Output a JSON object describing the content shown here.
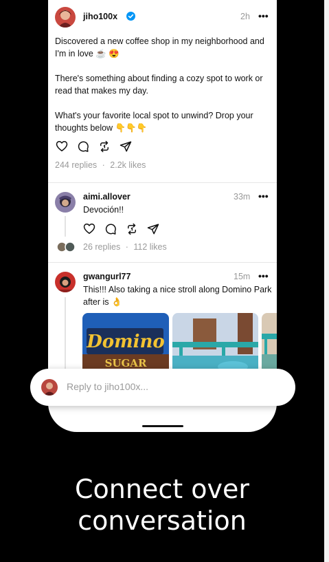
{
  "main_post": {
    "username": "jiho100x",
    "verified": true,
    "time": "2h",
    "paragraphs": [
      "Discovered a new coffee shop in my neighborhood and I'm in love ☕ 😍",
      "There's something about finding a cozy spot to work or read that makes my day.",
      "What's your favorite local spot to unwind? Drop your thoughts below 👇👇👇"
    ],
    "replies": "244 replies",
    "likes": "2.2k likes"
  },
  "reply_one": {
    "username": "aimi.allover",
    "time": "33m",
    "text": "Devoción!!",
    "replies": "26 replies",
    "likes": "112 likes"
  },
  "reply_two": {
    "username": "gwangurl77",
    "time": "15m",
    "text": "This!!! Also taking a nice stroll along Domino Park after is 👌",
    "photo_sign_top": "Domino",
    "photo_sign_bottom": "SUGAR"
  },
  "stats_separator": "·",
  "more_glyph": "•••",
  "reply_bar": {
    "placeholder": "Reply to jiho100x..."
  },
  "headline": {
    "line1": "Connect over",
    "line2": "conversation"
  },
  "icons": [
    "verified-badge-icon",
    "more-icon",
    "heart-icon",
    "comment-icon",
    "repost-icon",
    "share-icon"
  ],
  "colors": {
    "background": "#000000",
    "verified": "#0095f6",
    "muted_text": "#999999"
  }
}
